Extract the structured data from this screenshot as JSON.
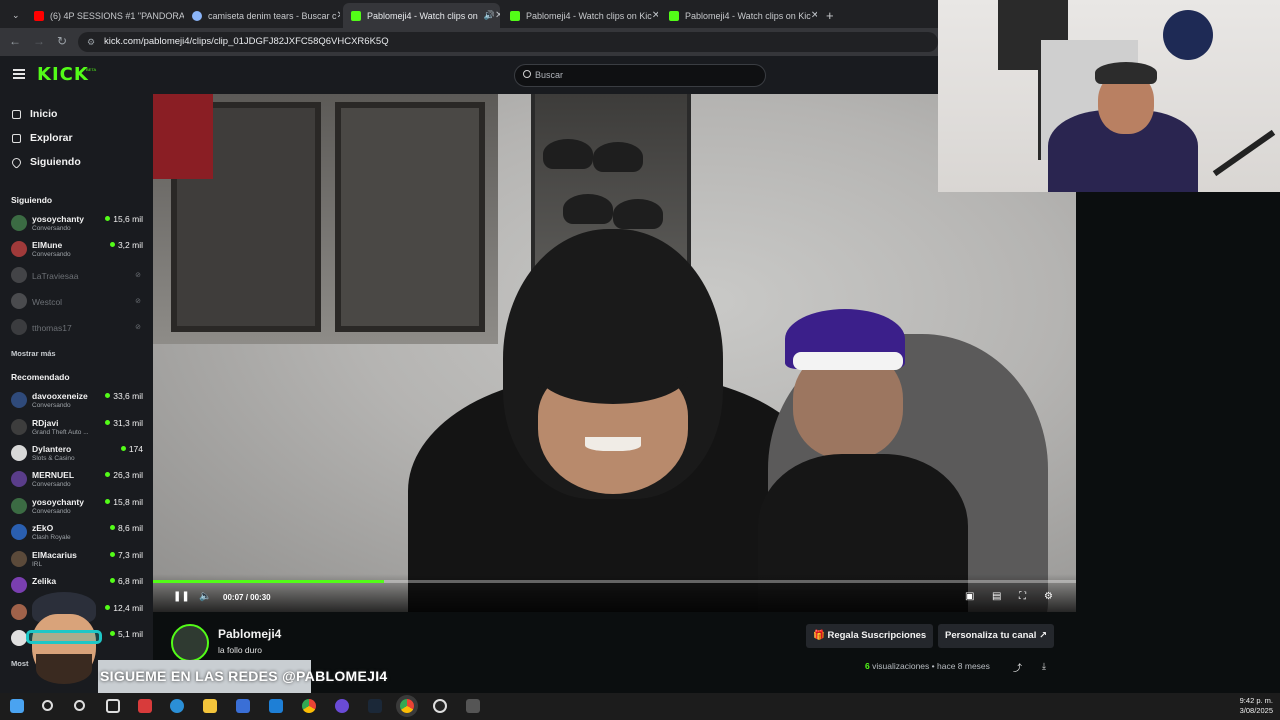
{
  "browser": {
    "tabs": [
      {
        "title": "(6) 4P SESSIONS #1 \"PANDORA",
        "favicon_color": "#ff0000"
      },
      {
        "title": "camiseta denim tears - Buscar c",
        "favicon_color": "#8ab4f8"
      },
      {
        "title": "Pablomeji4 - Watch clips on",
        "favicon_color": "#53fc18",
        "active": true
      },
      {
        "title": "Pablomeji4 - Watch clips on Kic",
        "favicon_color": "#53fc18"
      },
      {
        "title": "Pablomeji4 - Watch clips on Kic",
        "favicon_color": "#53fc18"
      }
    ],
    "url": "kick.com/pablomeji4/clips/clip_01JDGFJ82JXFC58Q6VHCXR6K5Q"
  },
  "header": {
    "logo": "KICK",
    "logo_badge": "BETA",
    "search_placeholder": "Buscar"
  },
  "sidebar": {
    "nav": [
      {
        "label": "Inicio",
        "icon": "home-icon"
      },
      {
        "label": "Explorar",
        "icon": "explore-icon"
      },
      {
        "label": "Siguiendo",
        "icon": "heart-icon"
      }
    ],
    "following_title": "Siguiendo",
    "following": [
      {
        "name": "yosoychanty",
        "category": "Conversando",
        "viewers": "15,6 mil",
        "avatar_color": "#3b6b43"
      },
      {
        "name": "ElMune",
        "category": "Conversando",
        "viewers": "3,2 mil",
        "avatar_color": "#a03a3a"
      },
      {
        "name": "LaTraviesaa",
        "offline": true,
        "avatar_color": "#777777"
      },
      {
        "name": "Westcol",
        "offline": true,
        "avatar_color": "#888888"
      },
      {
        "name": "tthomas17",
        "offline": true,
        "avatar_color": "#666666"
      }
    ],
    "show_more": "Mostrar más",
    "recommended_title": "Recomendado",
    "recommended": [
      {
        "name": "davooxeneize",
        "category": "Conversando",
        "viewers": "33,6 mil",
        "avatar_color": "#2f4a7a"
      },
      {
        "name": "RDjavi",
        "category": "Grand Theft Auto ...",
        "viewers": "31,3 mil",
        "avatar_color": "#3d3d3d"
      },
      {
        "name": "Dylantero",
        "category": "Slots & Casino",
        "viewers": "174",
        "avatar_color": "#d8d8d8"
      },
      {
        "name": "MERNUEL",
        "category": "Conversando",
        "viewers": "26,3 mil",
        "avatar_color": "#5a3d8a"
      },
      {
        "name": "yosoychanty",
        "category": "Conversando",
        "viewers": "15,8 mil",
        "avatar_color": "#3b6b43"
      },
      {
        "name": "zEkO",
        "category": "Clash Royale",
        "viewers": "8,6 mil",
        "avatar_color": "#2a5fb0"
      },
      {
        "name": "ElMacarius",
        "category": "IRL",
        "viewers": "7,3 mil",
        "avatar_color": "#5b4a3a"
      },
      {
        "name": "Zelika",
        "category": "",
        "viewers": "6,8 mil",
        "avatar_color": "#7a3fb0"
      },
      {
        "name": "",
        "category": "",
        "viewers": "12,4 mil",
        "avatar_color": "#a0624a"
      },
      {
        "name": "",
        "category": "",
        "viewers": "5,1 mil",
        "avatar_color": "#e0e0e0"
      }
    ],
    "show_more_bottom": "Most"
  },
  "player": {
    "current_time": "00:07",
    "duration": "00:30",
    "progress": 0.25
  },
  "channel": {
    "name": "Pablomeji4",
    "clip_title": "la follo duro",
    "gift_button": "Regala Suscripciones",
    "customize_button": "Personaliza tu canal",
    "views": "6",
    "views_label": "visualizaciones",
    "ago": "hace 8 meses"
  },
  "overlay": {
    "banner_text": "SIGUEME EN LAS REDES @PABLOMEJI4"
  },
  "taskbar": {
    "time": "9:42 p. m.",
    "date": "3/08/2025"
  },
  "colors": {
    "kick_green": "#53fc18",
    "sidebar_bg": "#191b1f",
    "page_bg": "#0b0e0f"
  }
}
